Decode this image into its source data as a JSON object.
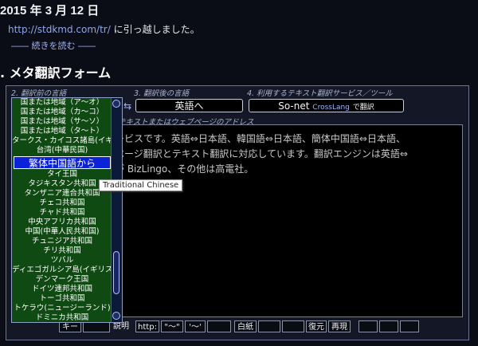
{
  "post": {
    "date": "2015 年 3 月 12 日",
    "moved_url": "http://stdkmd.com/tr/",
    "moved_text": " に引っ越しました。",
    "read_more": "―― 続きを読む ――"
  },
  "section": {
    "heading": ". メタ翻訳フォーム"
  },
  "form": {
    "label_source_lang": "2. 翻訳前の言語",
    "swap_icon": "⇆",
    "label_target_lang": "3. 翻訳後の言語",
    "target_button": "英語へ",
    "label_service": "4. 利用するテキスト翻訳サービス／ツール",
    "service_button_main": "So-net",
    "service_button_brand": "CrossLang",
    "service_button_suffix": "で翻訳",
    "label_input": "テキストまたはウェブページのアドレス",
    "textarea_lines": [
      "ービスです。英語⇔日本語、韓国語⇔日本語、簡体中国語⇔日本語、",
      "ページ翻訳とテキスト翻訳に対応しています。翻訳エンジンは英語⇔",
      "が BizLingo、その他は高電社。"
    ],
    "textarea_brand": "BizLingo"
  },
  "dropdown": {
    "items": [
      "国または地域（ア〜オ）",
      "国または地域（カ〜コ）",
      "国または地域（サ〜ソ）",
      "国または地域（タ〜ト）",
      "タークス・カイコス諸島(イギリス)",
      "台湾(中華民国)",
      "繁体中国語から",
      "タイ王国",
      "タジキスタン共和国",
      "タンザニア連合共和国",
      "チェコ共和国",
      "チャド共和国",
      "中央アフリカ共和国",
      "中国(中華人民共和国)",
      "チュニジア共和国",
      "チリ共和国",
      "ツバル",
      "ディエゴガルシア島(イギリス)",
      "デンマーク王国",
      "ドイツ連邦共和国",
      "トーゴ共和国",
      "トケラウ(ニュージーランド)",
      "ドミニカ共和国"
    ],
    "selected_index": 6,
    "tooltip": "Traditional Chinese"
  },
  "toolbar": {
    "key": "キー",
    "explain": "説明",
    "http": "http:",
    "quote1": "\"〜\"",
    "quote2": "'〜'",
    "blank": "白紙",
    "restore": "復元",
    "replay": "再現"
  },
  "colors": {
    "background": "#0b0d16",
    "dropdown_bg": "#0f4a12",
    "selected_bg": "#0b22d8"
  }
}
